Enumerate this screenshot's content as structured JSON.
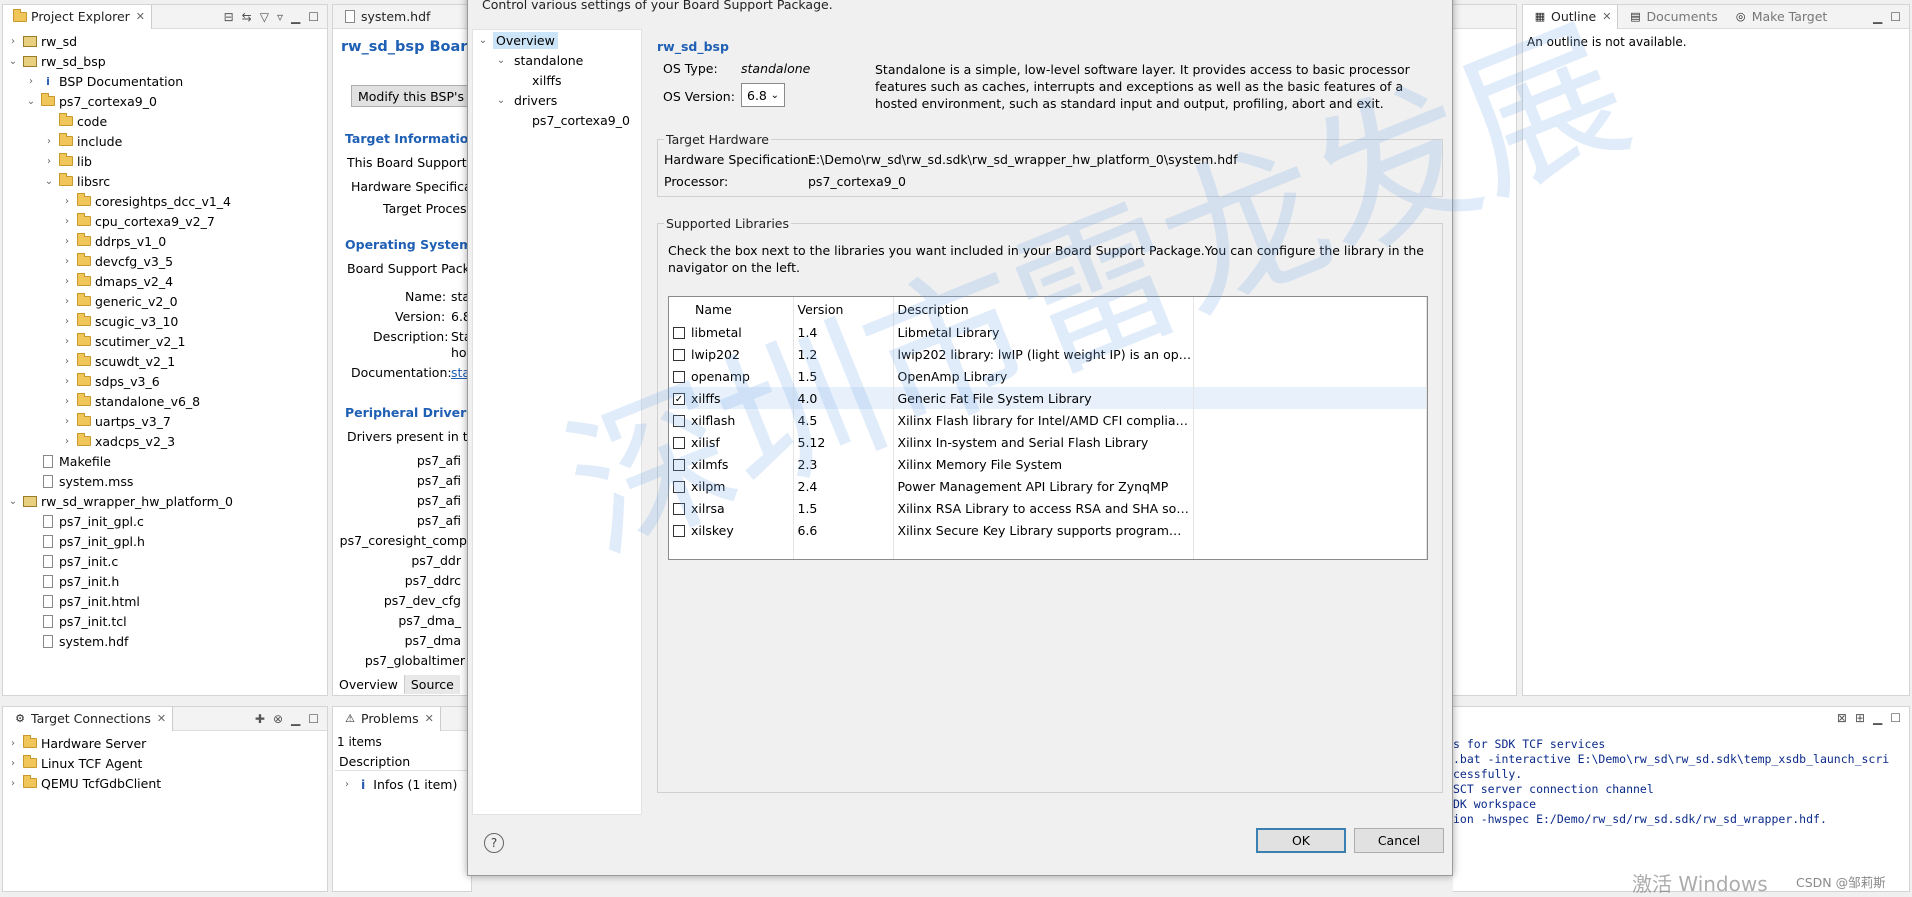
{
  "project_explorer": {
    "title": "Project Explorer",
    "items": [
      {
        "label": "rw_sd",
        "depth": 0,
        "twisty": "›",
        "icon": "project"
      },
      {
        "label": "rw_sd_bsp",
        "depth": 0,
        "twisty": "⌄",
        "icon": "project"
      },
      {
        "label": "BSP Documentation",
        "depth": 1,
        "twisty": "›",
        "icon": "info"
      },
      {
        "label": "ps7_cortexa9_0",
        "depth": 1,
        "twisty": "⌄",
        "icon": "folder"
      },
      {
        "label": "code",
        "depth": 2,
        "twisty": "",
        "icon": "folder"
      },
      {
        "label": "include",
        "depth": 2,
        "twisty": "›",
        "icon": "folder"
      },
      {
        "label": "lib",
        "depth": 2,
        "twisty": "›",
        "icon": "folder"
      },
      {
        "label": "libsrc",
        "depth": 2,
        "twisty": "⌄",
        "icon": "folder"
      },
      {
        "label": "coresightps_dcc_v1_4",
        "depth": 3,
        "twisty": "›",
        "icon": "folder"
      },
      {
        "label": "cpu_cortexa9_v2_7",
        "depth": 3,
        "twisty": "›",
        "icon": "folder"
      },
      {
        "label": "ddrps_v1_0",
        "depth": 3,
        "twisty": "›",
        "icon": "folder"
      },
      {
        "label": "devcfg_v3_5",
        "depth": 3,
        "twisty": "›",
        "icon": "folder"
      },
      {
        "label": "dmaps_v2_4",
        "depth": 3,
        "twisty": "›",
        "icon": "folder"
      },
      {
        "label": "generic_v2_0",
        "depth": 3,
        "twisty": "›",
        "icon": "folder"
      },
      {
        "label": "scugic_v3_10",
        "depth": 3,
        "twisty": "›",
        "icon": "folder"
      },
      {
        "label": "scutimer_v2_1",
        "depth": 3,
        "twisty": "›",
        "icon": "folder"
      },
      {
        "label": "scuwdt_v2_1",
        "depth": 3,
        "twisty": "›",
        "icon": "folder"
      },
      {
        "label": "sdps_v3_6",
        "depth": 3,
        "twisty": "›",
        "icon": "folder"
      },
      {
        "label": "standalone_v6_8",
        "depth": 3,
        "twisty": "›",
        "icon": "folder"
      },
      {
        "label": "uartps_v3_7",
        "depth": 3,
        "twisty": "›",
        "icon": "folder"
      },
      {
        "label": "xadcps_v2_3",
        "depth": 3,
        "twisty": "›",
        "icon": "folder"
      },
      {
        "label": "Makefile",
        "depth": 1,
        "twisty": "",
        "icon": "file"
      },
      {
        "label": "system.mss",
        "depth": 1,
        "twisty": "",
        "icon": "file"
      },
      {
        "label": "rw_sd_wrapper_hw_platform_0",
        "depth": 0,
        "twisty": "⌄",
        "icon": "project"
      },
      {
        "label": "ps7_init_gpl.c",
        "depth": 1,
        "twisty": "",
        "icon": "file"
      },
      {
        "label": "ps7_init_gpl.h",
        "depth": 1,
        "twisty": "",
        "icon": "file"
      },
      {
        "label": "ps7_init.c",
        "depth": 1,
        "twisty": "",
        "icon": "file"
      },
      {
        "label": "ps7_init.h",
        "depth": 1,
        "twisty": "",
        "icon": "file"
      },
      {
        "label": "ps7_init.html",
        "depth": 1,
        "twisty": "",
        "icon": "file"
      },
      {
        "label": "ps7_init.tcl",
        "depth": 1,
        "twisty": "",
        "icon": "file"
      },
      {
        "label": "system.hdf",
        "depth": 1,
        "twisty": "",
        "icon": "file"
      }
    ]
  },
  "editor": {
    "tab": "system.hdf",
    "title": "rw_sd_bsp Board",
    "modify_button": "Modify this BSP's S",
    "target_info_heading": "Target Information",
    "target_info_text": "This Board Support P",
    "hw_spec_label": "Hardware Specificati",
    "target_proc_label": "Target Process",
    "os_heading": "Operating System",
    "os_text": "Board Support Packa",
    "name_label": "Name:",
    "name_value": "sta",
    "version_label": "Version:",
    "version_value": "6.8",
    "description_label": "Description:",
    "description_value1": "Sta",
    "description_value2": "hos",
    "doc_label": "Documentation:",
    "doc_value": "sta",
    "periph_heading": "Peripheral Drivers",
    "periph_text": "Drivers present in th",
    "drivers": [
      "ps7_afi",
      "ps7_afi",
      "ps7_afi",
      "ps7_afi",
      "ps7_coresight_comp",
      "ps7_ddr",
      "ps7_ddrc",
      "ps7_dev_cfg",
      "ps7_dma_",
      "ps7_dma",
      "ps7_globaltimer"
    ],
    "bottom_tabs": [
      "Overview",
      "Source"
    ]
  },
  "dialog": {
    "header_text": "Control various settings of your Board Support Package.",
    "nav": [
      {
        "label": "Overview",
        "depth": 0,
        "twisty": "⌄",
        "selected": true
      },
      {
        "label": "standalone",
        "depth": 1,
        "twisty": "⌄",
        "selected": false
      },
      {
        "label": "xilffs",
        "depth": 2,
        "twisty": "",
        "selected": false
      },
      {
        "label": "drivers",
        "depth": 1,
        "twisty": "⌄",
        "selected": false
      },
      {
        "label": "ps7_cortexa9_0",
        "depth": 2,
        "twisty": "",
        "selected": false
      }
    ],
    "bsp_name": "rw_sd_bsp",
    "os_type_label": "OS Type:",
    "os_type_value": "standalone",
    "os_version_label": "OS Version:",
    "os_version_value": "6.8",
    "os_description": "Standalone is a simple, low-level software layer. It provides access to basic processor features such as caches, interrupts and exceptions as well as the basic features of a hosted environment, such as standard input and output, profiling, abort and exit.",
    "target_hw_title": "Target Hardware",
    "hw_spec_label": "Hardware Specification:",
    "hw_spec_value": "E:\\Demo\\rw_sd\\rw_sd.sdk\\rw_sd_wrapper_hw_platform_0\\system.hdf",
    "processor_label": "Processor:",
    "processor_value": "ps7_cortexa9_0",
    "libs_title": "Supported Libraries",
    "libs_intro": "Check the box next to the libraries you want included in your Board Support Package.You can configure the library in the navigator on the left.",
    "columns": [
      "Name",
      "Version",
      "Description"
    ],
    "libraries": [
      {
        "name": "libmetal",
        "version": "1.4",
        "description": "Libmetal Library",
        "checked": false
      },
      {
        "name": "lwip202",
        "version": "1.2",
        "description": "lwip202 library: lwIP (light weight IP) is an open...",
        "checked": false
      },
      {
        "name": "openamp",
        "version": "1.5",
        "description": "OpenAmp Library",
        "checked": false
      },
      {
        "name": "xilffs",
        "version": "4.0",
        "description": "Generic Fat File System Library",
        "checked": true
      },
      {
        "name": "xilflash",
        "version": "4.5",
        "description": "Xilinx Flash library for Intel/AMD CFI compliant ...",
        "checked": false
      },
      {
        "name": "xilisf",
        "version": "5.12",
        "description": "Xilinx In-system and Serial Flash Library",
        "checked": false
      },
      {
        "name": "xilmfs",
        "version": "2.3",
        "description": "Xilinx Memory File System",
        "checked": false
      },
      {
        "name": "xilpm",
        "version": "2.4",
        "description": "Power Management API Library for ZynqMP",
        "checked": false
      },
      {
        "name": "xilrsa",
        "version": "1.5",
        "description": "Xilinx RSA Library to access RSA and SHA softw...",
        "checked": false
      },
      {
        "name": "xilskey",
        "version": "6.6",
        "description": "Xilinx Secure Key Library supports programmin...",
        "checked": false
      }
    ],
    "help": "?",
    "ok": "OK",
    "cancel": "Cancel"
  },
  "outline": {
    "tabs": [
      "Outline",
      "Documents",
      "Make Target"
    ],
    "message": "An outline is not available."
  },
  "target_connections": {
    "title": "Target Connections",
    "items": [
      "Hardware Server",
      "Linux TCF Agent",
      "QEMU TcfGdbClient"
    ]
  },
  "problems": {
    "tab": "Problems",
    "count": "1 items",
    "column": "Description",
    "row": "Infos (1 item)"
  },
  "console": {
    "lines": [
      "s for SDK TCF services",
      ".bat -interactive E:\\Demo\\rw_sd\\rw_sd.sdk\\temp_xsdb_launch_scri",
      "cessfully.",
      "SCT server connection channel",
      "DK workspace",
      "ion -hwspec E:/Demo/rw_sd/rw_sd.sdk/rw_sd_wrapper.hdf."
    ]
  },
  "watermark": "深圳市雷龙发展",
  "os_watermark": "激活 Windows",
  "csdn_tag": "CSDN @邹莉斯",
  "colors": {
    "link_blue": "#1f5fb4",
    "accent": "#3c7fb1",
    "selection": "#cce4f7"
  }
}
